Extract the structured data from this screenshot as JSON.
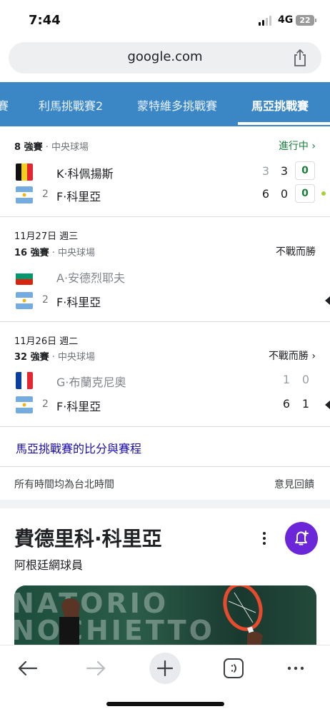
{
  "status": {
    "time": "7:44",
    "network": "4G",
    "battery": "22"
  },
  "browser": {
    "url": "google.com"
  },
  "tabs": [
    "賽",
    "利馬挑戰賽2",
    "蒙特維多挑戰賽",
    "馬亞挑戰賽"
  ],
  "matches": [
    {
      "date": "",
      "round": "8 強賽",
      "venue": "· 中央球場",
      "status": "進行中 ›",
      "players": [
        {
          "flag": "belgium",
          "seed": "",
          "name": "K·科佩揚斯",
          "scores": [
            "3",
            "3"
          ],
          "game": "0",
          "loser": false
        },
        {
          "flag": "argentina",
          "seed": "2",
          "name": "F·科里亞",
          "scores": [
            "6",
            "0"
          ],
          "game": "0",
          "loser": false
        }
      ]
    },
    {
      "date": "11月27日 週三",
      "round": "16 強賽",
      "venue": "· 中央球場",
      "status": "不戰而勝",
      "players": [
        {
          "flag": "bulgaria",
          "seed": "",
          "name": "A·安德烈耶夫",
          "loser": true
        },
        {
          "flag": "argentina",
          "seed": "2",
          "name": "F·科里亞",
          "loser": false
        }
      ]
    },
    {
      "date": "11月26日 週二",
      "round": "32 強賽",
      "venue": "· 中央球場",
      "status": "不戰而勝 ›",
      "players": [
        {
          "flag": "france",
          "seed": "",
          "name": "G·布蘭克尼奧",
          "scores": [
            "1",
            "0"
          ],
          "loser": true
        },
        {
          "flag": "argentina",
          "seed": "2",
          "name": "F·科里亞",
          "scores": [
            "6",
            "1"
          ],
          "loser": false
        }
      ]
    }
  ],
  "links": {
    "more_scores": "馬亞挑戰賽的比分與賽程"
  },
  "footer": {
    "timezone": "所有時間均為台北時間",
    "feedback": "意見回饋"
  },
  "knowledge_panel": {
    "name": "費德里科·科里亞",
    "description": "阿根廷網球員",
    "image_text": "NATORIO\nNOCHIETTO"
  },
  "colors": {
    "tab_bar": "#3b87c6",
    "live": "#188038",
    "link": "#1a0dab",
    "follow": "#6b26d9"
  },
  "toolbar_icons": [
    "back-arrow-icon",
    "forward-arrow-icon",
    "new-tab-plus-icon",
    "tab-switcher-icon",
    "more-dots-icon"
  ]
}
